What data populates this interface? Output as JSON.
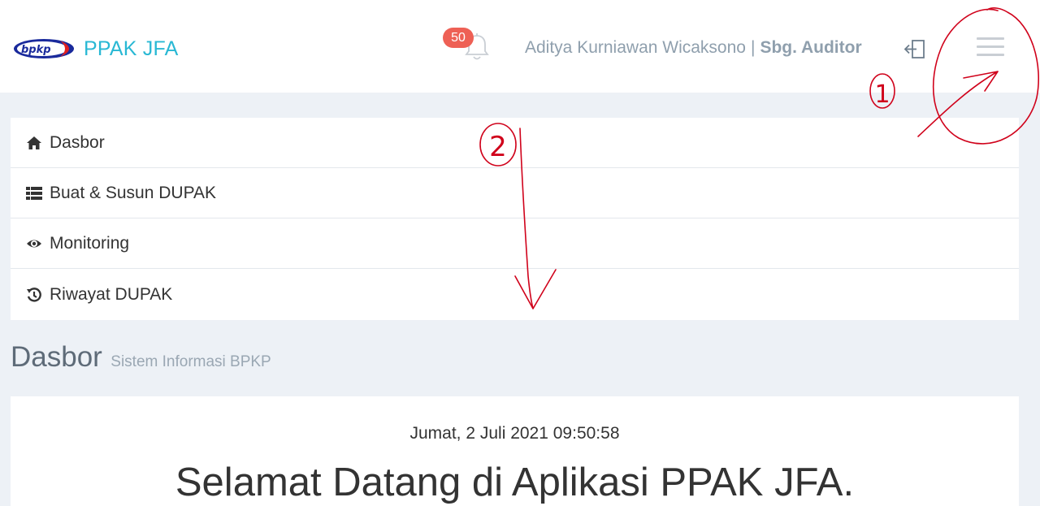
{
  "brand": {
    "logo_text": "bpkp",
    "name": "PPAK JFA"
  },
  "notifications": {
    "count": "50"
  },
  "user": {
    "name": "Aditya Kurniawan Wicaksono",
    "separator": "|",
    "role": "Sbg. Auditor"
  },
  "menu": {
    "items": [
      {
        "label": "Dasbor",
        "icon": "home-icon"
      },
      {
        "label": "Buat & Susun DUPAK",
        "icon": "list-icon"
      },
      {
        "label": "Monitoring",
        "icon": "eye-icon"
      },
      {
        "label": "Riwayat DUPAK",
        "icon": "history-icon"
      }
    ]
  },
  "page": {
    "title": "Dasbor",
    "subtitle": "Sistem Informasi BPKP"
  },
  "card": {
    "datetime": "Jumat, 2 Juli 2021 09:50:58",
    "welcome": "Selamat Datang di Aplikasi PPAK JFA."
  },
  "annotations": {
    "mark_1": "1",
    "mark_2": "2",
    "color": "#d0021b"
  },
  "colors": {
    "brand": "#29b8d4",
    "badge": "#ee6055",
    "background": "#edf1f6"
  }
}
